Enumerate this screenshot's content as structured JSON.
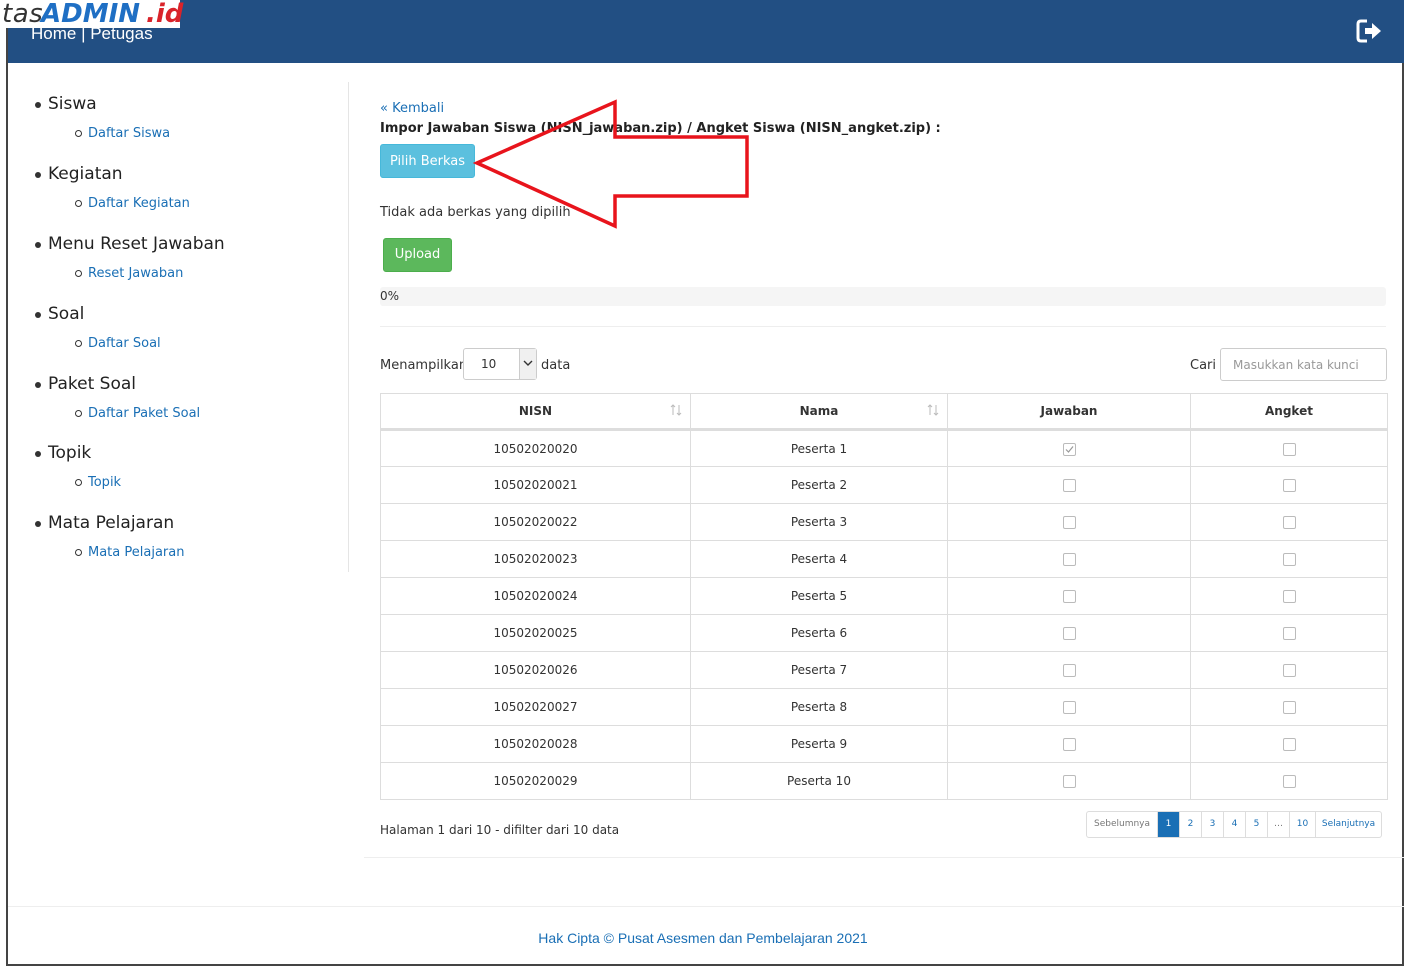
{
  "brand": {
    "part1": "tas",
    "part2": "ADMIN",
    "part3": ".id"
  },
  "header": {
    "breadcrumb": "Home | Petugas",
    "logout_icon": "sign-out-icon",
    "bar_color": "#224f83"
  },
  "sidebar": {
    "groups": [
      {
        "title": "Siswa",
        "link": "Daftar Siswa"
      },
      {
        "title": "Kegiatan",
        "link": "Daftar Kegiatan"
      },
      {
        "title": "Menu Reset Jawaban",
        "link": "Reset Jawaban"
      },
      {
        "title": "Soal",
        "link": "Daftar Soal"
      },
      {
        "title": "Paket Soal",
        "link": "Daftar Paket Soal"
      },
      {
        "title": "Topik",
        "link": "Topik"
      },
      {
        "title": "Mata Pelajaran",
        "link": "Mata Pelajaran"
      }
    ]
  },
  "main": {
    "back_link": "« Kembali",
    "import_label": "Impor Jawaban Siswa (NISN_jawaban.zip) / Angket Siswa (NISN_angket.zip) :",
    "choose_button": "Pilih Berkas",
    "no_file_text": "Tidak ada berkas yang dipilih",
    "upload_button": "Upload",
    "progress": {
      "value": 0,
      "text": "0%"
    }
  },
  "table_controls": {
    "length_label": "Menampilkan",
    "length_value": "10",
    "length_suffix": "data",
    "search_label": "Cari",
    "search_placeholder": "Masukkan kata kunci"
  },
  "table": {
    "headers": [
      "NISN",
      "Nama",
      "Jawaban",
      "Angket"
    ],
    "rows": [
      {
        "nisn": "10502020020",
        "nama": "Peserta 1",
        "jawaban": true,
        "angket": false
      },
      {
        "nisn": "10502020021",
        "nama": "Peserta 2",
        "jawaban": false,
        "angket": false
      },
      {
        "nisn": "10502020022",
        "nama": "Peserta 3",
        "jawaban": false,
        "angket": false
      },
      {
        "nisn": "10502020023",
        "nama": "Peserta 4",
        "jawaban": false,
        "angket": false
      },
      {
        "nisn": "10502020024",
        "nama": "Peserta 5",
        "jawaban": false,
        "angket": false
      },
      {
        "nisn": "10502020025",
        "nama": "Peserta 6",
        "jawaban": false,
        "angket": false
      },
      {
        "nisn": "10502020026",
        "nama": "Peserta 7",
        "jawaban": false,
        "angket": false
      },
      {
        "nisn": "10502020027",
        "nama": "Peserta 8",
        "jawaban": false,
        "angket": false
      },
      {
        "nisn": "10502020028",
        "nama": "Peserta 9",
        "jawaban": false,
        "angket": false
      },
      {
        "nisn": "10502020029",
        "nama": "Peserta 10",
        "jawaban": false,
        "angket": false
      }
    ]
  },
  "pagination": {
    "info": "Halaman 1 dari 10 - difilter dari 10 data",
    "pages": [
      {
        "label": "Sebelumnya",
        "state": "disabled"
      },
      {
        "label": "1",
        "state": "active"
      },
      {
        "label": "2",
        "state": ""
      },
      {
        "label": "3",
        "state": ""
      },
      {
        "label": "4",
        "state": ""
      },
      {
        "label": "5",
        "state": ""
      },
      {
        "label": "…",
        "state": "disabled"
      },
      {
        "label": "10",
        "state": ""
      },
      {
        "label": "Selanjutnya",
        "state": ""
      }
    ]
  },
  "footer": {
    "text": "Hak Cipta © Pusat Asesmen dan Pembelajaran 2021"
  },
  "annotation": {
    "color": "#e8141c"
  }
}
